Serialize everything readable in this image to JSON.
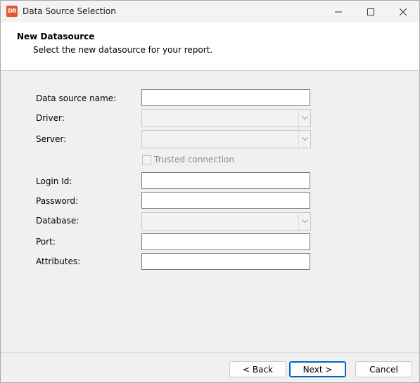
{
  "window": {
    "title": "Data Source Selection",
    "app_icon_text": "DR"
  },
  "header": {
    "title": "New Datasource",
    "subtitle": "Select the new datasource for your report."
  },
  "form": {
    "datasource_name_label": "Data source name:",
    "datasource_name_value": "",
    "driver_label": "Driver:",
    "driver_value": "",
    "server_label": "Server:",
    "server_value": "",
    "trusted_connection_label": "Trusted connection",
    "trusted_connection_checked": false,
    "login_id_label": "Login Id:",
    "login_id_value": "",
    "password_label": "Password:",
    "password_value": "",
    "database_label": "Database:",
    "database_value": "",
    "port_label": "Port:",
    "port_value": "",
    "attributes_label": "Attributes:",
    "attributes_value": ""
  },
  "footer": {
    "back_label": "< Back",
    "next_label": "Next >",
    "cancel_label": "Cancel"
  }
}
